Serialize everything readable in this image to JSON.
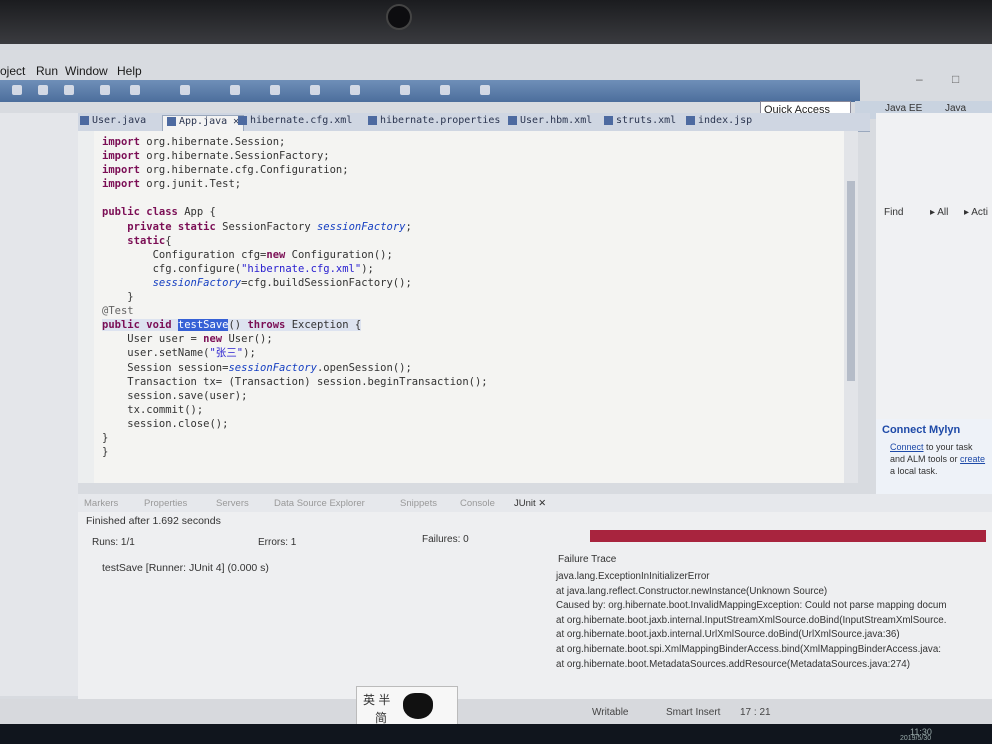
{
  "menu": {
    "items": [
      "oject",
      "Run",
      "Window",
      "Help"
    ]
  },
  "window_buttons": {
    "minimize": "–",
    "maximize": "□"
  },
  "quick_access": {
    "placeholder": "Quick Access"
  },
  "perspectives": {
    "java_ee": "Java EE",
    "java": "Java"
  },
  "editor_tabs": [
    {
      "label": "User.java",
      "active": false
    },
    {
      "label": "App.java ✕",
      "active": true
    },
    {
      "label": "hibernate.cfg.xml",
      "active": false
    },
    {
      "label": "hibernate.properties",
      "active": false
    },
    {
      "label": "User.hbm.xml",
      "active": false
    },
    {
      "label": "struts.xml",
      "active": false
    },
    {
      "label": "index.jsp",
      "active": false
    }
  ],
  "code": {
    "imp": "import",
    "l1": " org.hibernate.Session;",
    "l2": " org.hibernate.SessionFactory;",
    "l3": " org.hibernate.cfg.Configuration;",
    "l4": " org.junit.Test;",
    "public": "public",
    "class": "class",
    "classname": " App {",
    "private": "private",
    "static": "static",
    "sf_type": " SessionFactory ",
    "sf_name": "sessionFactory",
    "semi": ";",
    "static_open": "{",
    "cfg1": "Configuration cfg=",
    "new": "new",
    "cfg1b": " Configuration();",
    "cfg2a": "cfg.configure(",
    "cfg2s": "\"hibernate.cfg.xml\"",
    "cfg2b": ");",
    "cfg3b": "=cfg.buildSessionFactory();",
    "close1": "}",
    "test_ann": "@Test",
    "void": "void",
    "method": "testSave",
    "throws": "throws",
    "sig_rest": "() ",
    "sig_exc": " Exception {",
    "u1a": "User user = ",
    "u1b": " User();",
    "u2a": "user.setName(",
    "u2s": "\"张三\"",
    "u2b": ");",
    "s1a": "Session session=",
    "s1b": ".openSession();",
    "t1": "Transaction tx= (Transaction) session.beginTransaction();",
    "save": "session.save(user);",
    "commit": "tx.commit();",
    "sclose": "session.close();",
    "close2": "}",
    "close3": "}"
  },
  "outline": {
    "find_label": "Find",
    "all_label": "▸ All",
    "acti_label": "▸ Acti"
  },
  "mylyn": {
    "title": "Connect Mylyn",
    "connect": "Connect",
    "text1": " to your task and ALM tools or ",
    "create": "create",
    "text2": " a local task."
  },
  "panel_tabs": [
    "Markers",
    "Properties",
    "Servers",
    "Data Source Explorer",
    "Snippets",
    "Console",
    "JUnit ✕"
  ],
  "junit": {
    "finished": "Finished after 1.692 seconds",
    "runs": "Runs:  1/1",
    "errors": "Errors:  1",
    "failures": "Failures:  0",
    "test_row": "testSave [Runner: JUnit 4] (0.000 s)",
    "trace_title": "Failure Trace",
    "trace": [
      "java.lang.ExceptionInInitializerError",
      "at java.lang.reflect.Constructor.newInstance(Unknown Source)",
      "Caused by: org.hibernate.boot.InvalidMappingException: Could not parse mapping docum",
      "at org.hibernate.boot.jaxb.internal.InputStreamXmlSource.doBind(InputStreamXmlSource.",
      "at org.hibernate.boot.jaxb.internal.UrlXmlSource.doBind(UrlXmlSource.java:36)",
      "at org.hibernate.boot.spi.XmlMappingBinderAccess.bind(XmlMappingBinderAccess.java:",
      "at org.hibernate.boot.MetadataSources.addResource(MetadataSources.java:274)"
    ]
  },
  "status": {
    "writable": "Writable",
    "insert": "Smart Insert",
    "position": "17 : 21"
  },
  "ime": {
    "line1": "英  半",
    "line2": "简"
  },
  "taskbar": {
    "time": "11:30",
    "date": "2019/5/30"
  }
}
